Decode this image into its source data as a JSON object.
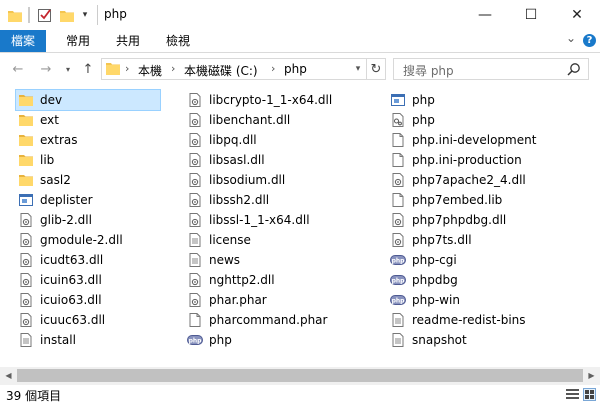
{
  "window": {
    "title": "php",
    "minimize": "—",
    "maximize": "☐",
    "close": "✕"
  },
  "ribbon": {
    "tabs": [
      "檔案",
      "常用",
      "共用",
      "檢視"
    ],
    "collapse_glyph": "⌄",
    "help_glyph": "?"
  },
  "address": {
    "crumbs": [
      "本機",
      "本機磁碟 (C:)",
      "php"
    ],
    "separator": "›"
  },
  "search": {
    "placeholder": "搜尋 php"
  },
  "files": {
    "col1": [
      {
        "name": "dev",
        "icon": "folder-icon"
      },
      {
        "name": "ext",
        "icon": "folder-icon"
      },
      {
        "name": "extras",
        "icon": "folder-icon"
      },
      {
        "name": "lib",
        "icon": "folder-icon"
      },
      {
        "name": "sasl2",
        "icon": "folder-icon"
      },
      {
        "name": "deplister",
        "icon": "app-icon"
      },
      {
        "name": "glib-2.dll",
        "icon": "dll-icon"
      },
      {
        "name": "gmodule-2.dll",
        "icon": "dll-icon"
      },
      {
        "name": "icudt63.dll",
        "icon": "dll-icon"
      },
      {
        "name": "icuin63.dll",
        "icon": "dll-icon"
      },
      {
        "name": "icuio63.dll",
        "icon": "dll-icon"
      },
      {
        "name": "icuuc63.dll",
        "icon": "dll-icon"
      },
      {
        "name": "install",
        "icon": "text-file-icon"
      }
    ],
    "col2": [
      {
        "name": "libcrypto-1_1-x64.dll",
        "icon": "dll-icon"
      },
      {
        "name": "libenchant.dll",
        "icon": "dll-icon"
      },
      {
        "name": "libpq.dll",
        "icon": "dll-icon"
      },
      {
        "name": "libsasl.dll",
        "icon": "dll-icon"
      },
      {
        "name": "libsodium.dll",
        "icon": "dll-icon"
      },
      {
        "name": "libssh2.dll",
        "icon": "dll-icon"
      },
      {
        "name": "libssl-1_1-x64.dll",
        "icon": "dll-icon"
      },
      {
        "name": "license",
        "icon": "text-file-icon"
      },
      {
        "name": "news",
        "icon": "text-file-icon"
      },
      {
        "name": "nghttp2.dll",
        "icon": "dll-icon"
      },
      {
        "name": "phar.phar",
        "icon": "dll-icon"
      },
      {
        "name": "pharcommand.phar",
        "icon": "blank-file-icon"
      },
      {
        "name": "php",
        "icon": "php-exe-icon"
      }
    ],
    "col3": [
      {
        "name": "php",
        "icon": "app-icon"
      },
      {
        "name": "php",
        "icon": "script-file-icon"
      },
      {
        "name": "php.ini-development",
        "icon": "blank-file-icon"
      },
      {
        "name": "php.ini-production",
        "icon": "blank-file-icon"
      },
      {
        "name": "php7apache2_4.dll",
        "icon": "dll-icon"
      },
      {
        "name": "php7embed.lib",
        "icon": "blank-file-icon"
      },
      {
        "name": "php7phpdbg.dll",
        "icon": "dll-icon"
      },
      {
        "name": "php7ts.dll",
        "icon": "dll-icon"
      },
      {
        "name": "php-cgi",
        "icon": "php-exe-icon"
      },
      {
        "name": "phpdbg",
        "icon": "php-exe-icon"
      },
      {
        "name": "php-win",
        "icon": "php-exe-icon"
      },
      {
        "name": "readme-redist-bins",
        "icon": "text-file-icon"
      },
      {
        "name": "snapshot",
        "icon": "text-file-icon"
      }
    ]
  },
  "selected": "dev",
  "status": {
    "count": "39 個項目"
  },
  "colors": {
    "accent": "#1979ca",
    "selection": "#cce8ff",
    "folder": "#f4c550"
  }
}
